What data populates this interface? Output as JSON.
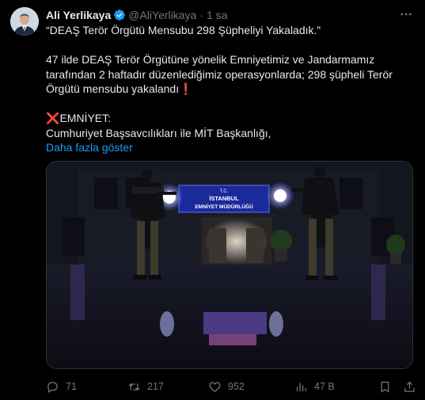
{
  "tweet": {
    "author_name": "Ali Yerlikaya",
    "handle": "@AliYerlikaya",
    "separator": "·",
    "time": "1 sa",
    "body": {
      "line_quote": "“DEAŞ Terör Örgütü Mensubu 298 Şüpheliyi Yakaladık.”",
      "p2_l1": "47 ilde DEAŞ Terör Örgütüne yönelik Emniyetimiz ve Jandarmamız",
      "p2_l2": "tarafından 2 haftadır düzenlediğimiz operasyonlarda; 298 şüpheli Terör",
      "p2_l3": "Örgütü mensubu yakalandı",
      "p2_l3_mark": "❗",
      "p3_mark": "❌",
      "p3_l1": "EMNİYET:",
      "p3_l2": "Cumhuriyet Başsavcılıkları ile MİT Başkanlığı,"
    },
    "show_more": "Daha fazla göster",
    "media": {
      "sign_line_1": "T.C.",
      "sign_line_2": "İSTANBUL",
      "sign_line_3": "EMNİYET MÜDÜRLÜĞÜ"
    },
    "actions": {
      "replies": "71",
      "reposts": "217",
      "likes": "952",
      "views": "47 B"
    }
  },
  "colors": {
    "background": "#000000",
    "text": "#e7e9ea",
    "secondary": "#71767b",
    "link": "#1d9bf0",
    "verified": "#1d9bf0",
    "alert": "#f4212e"
  }
}
